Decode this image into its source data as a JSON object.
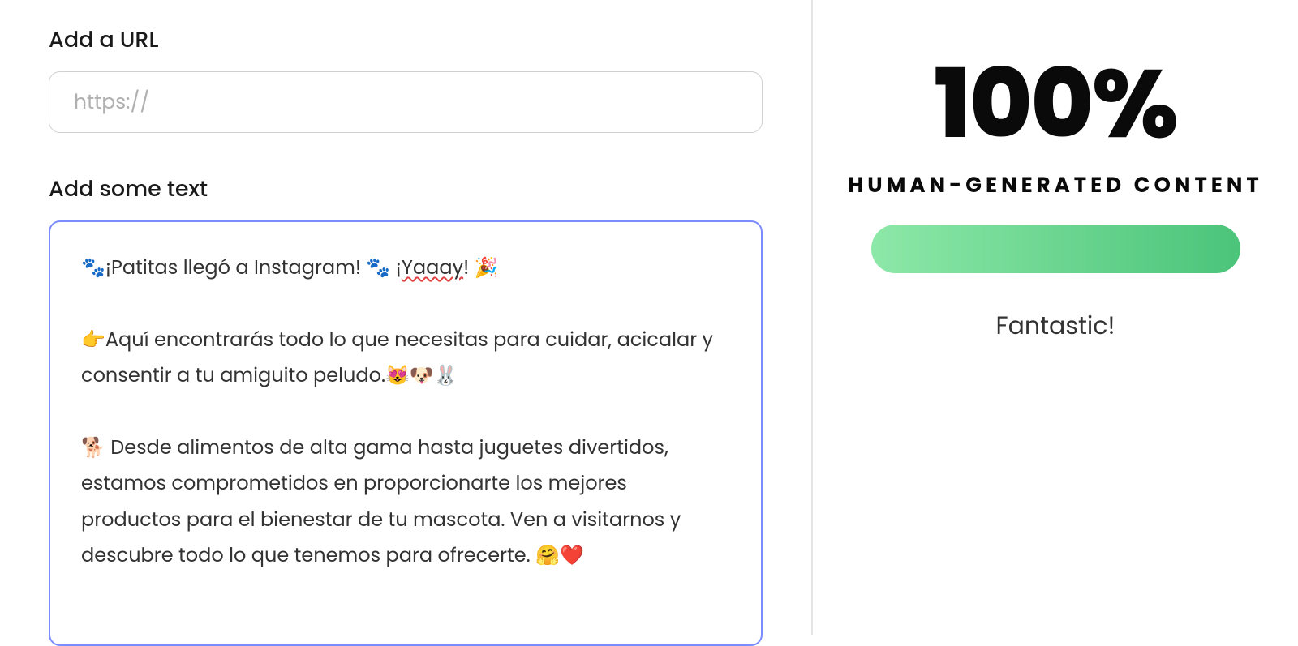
{
  "left": {
    "urlLabel": "Add a URL",
    "urlPlaceholder": "https://",
    "urlValue": "",
    "textLabel": "Add some text",
    "textLine1Pre": "🐾¡Patitas llegó a Instagram! 🐾 ¡",
    "textLine1Err": "Yaaay",
    "textLine1Post": "! 🎉",
    "textPara2": "👉Aquí encontrarás todo lo que necesitas para cuidar, acicalar y consentir a tu amiguito peludo.😻🐶🐰",
    "textPara3": "🐕 Desde alimentos de alta gama hasta juguetes divertidos, estamos comprometidos en proporcionarte los mejores productos para el bienestar de tu mascota. Ven a visitarnos y descubre todo lo que tenemos para ofrecerte. 🤗❤️"
  },
  "right": {
    "percent": "100%",
    "label": "HUMAN-GENERATED CONTENT",
    "status": "Fantastic!"
  }
}
